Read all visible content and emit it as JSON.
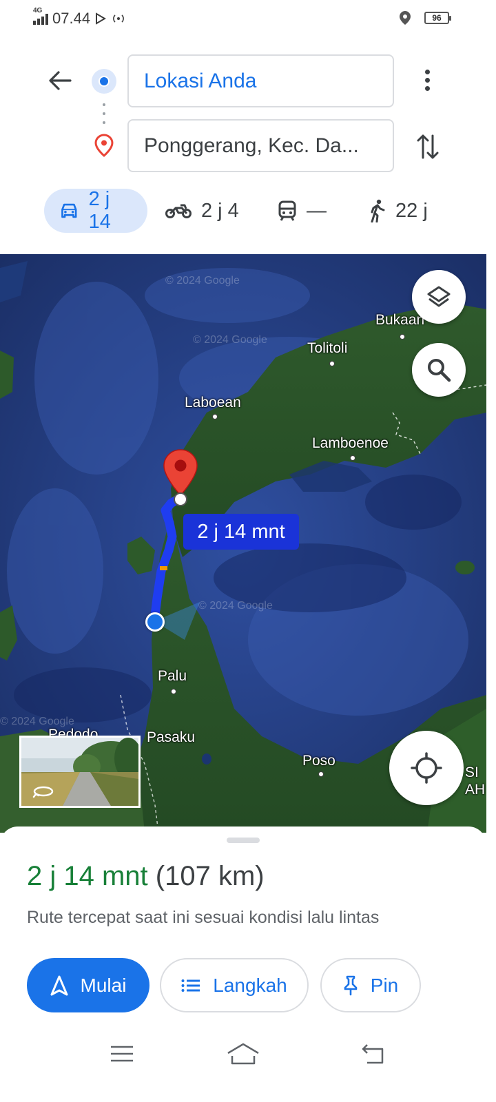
{
  "status_bar": {
    "network": "4G",
    "time": "07.44",
    "battery": "96",
    "icons": [
      "signal-icon",
      "play-icon",
      "hotspot-icon",
      "location-icon",
      "battery-icon"
    ]
  },
  "directions": {
    "origin": "Lokasi Anda",
    "destination": "Ponggerang, Kec. Da...",
    "icons": [
      "back-arrow-icon",
      "origin-dot-icon",
      "destination-pin-icon",
      "more-vert-icon",
      "swap-icon"
    ]
  },
  "modes": [
    {
      "name": "car",
      "label": "2 j 14",
      "icon": "car-icon",
      "active": true
    },
    {
      "name": "motorcycle",
      "label": "2 j 4",
      "icon": "motorcycle-icon",
      "active": false
    },
    {
      "name": "transit",
      "label": "—",
      "icon": "train-icon",
      "active": false
    },
    {
      "name": "walk",
      "label": "22 j",
      "icon": "walk-icon",
      "active": false
    }
  ],
  "map": {
    "places": [
      "Bukaan",
      "Tolitoli",
      "Laboean",
      "Lamboenoe",
      "Palu",
      "Pasaku",
      "Poso",
      "Pedodo",
      "SI",
      "AH"
    ],
    "watermark": "© 2024 Google",
    "route_label": "2 j 14 mnt",
    "buttons": [
      "layers-icon",
      "search-icon",
      "my-location-icon"
    ],
    "streetview_icon": "360-rotate-icon",
    "colors": {
      "route": "#1f3df0",
      "pin": "#ea4335",
      "label_bg": "#1a33d8"
    }
  },
  "summary": {
    "time": "2 j 14 mnt",
    "distance": "(107 km)",
    "description": "Rute tercepat saat ini sesuai kondisi lalu lintas"
  },
  "actions": {
    "start": "Mulai",
    "steps": "Langkah",
    "pin": "Pin"
  },
  "nav_bar": [
    "menu-icon",
    "home-icon",
    "back-icon"
  ]
}
